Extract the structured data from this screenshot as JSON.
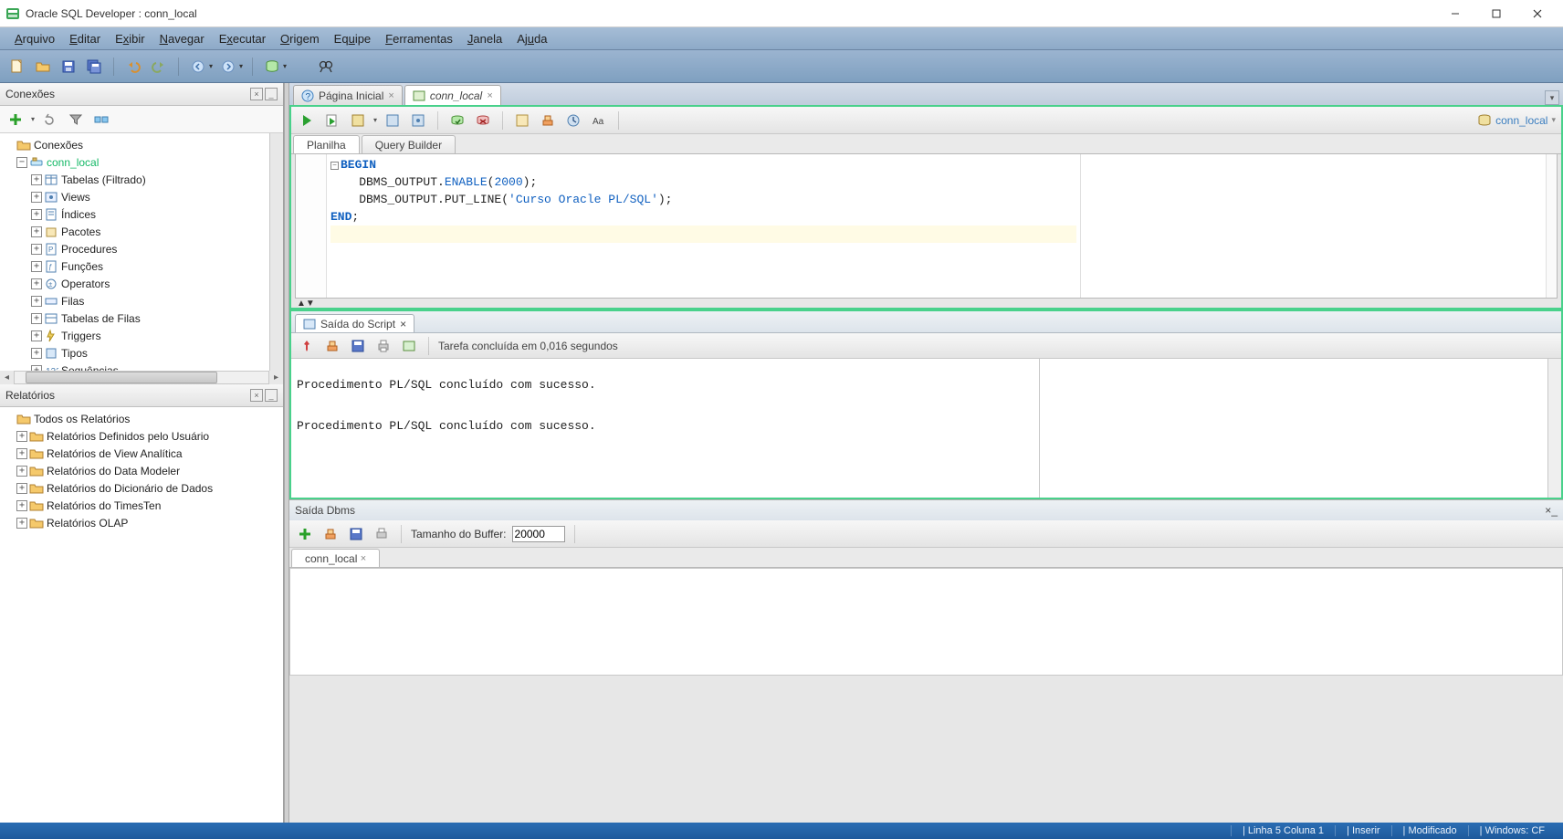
{
  "title": "Oracle SQL Developer : conn_local",
  "menubar": [
    "Arquivo",
    "Editar",
    "Exibir",
    "Navegar",
    "Executar",
    "Origem",
    "Equipe",
    "Ferramentas",
    "Janela",
    "Ajuda"
  ],
  "leftpanels": {
    "connections_title": "Conexões",
    "conn_root": "Conexões",
    "conn_name": "conn_local",
    "tree_items": [
      "Tabelas (Filtrado)",
      "Views",
      "Índices",
      "Pacotes",
      "Procedures",
      "Funções",
      "Operators",
      "Filas",
      "Tabelas de Filas",
      "Triggers",
      "Tipos",
      "Sequências"
    ],
    "reports_title": "Relatórios",
    "reports_root": "Todos os Relatórios",
    "reports_items": [
      "Relatórios Definidos pelo Usuário",
      "Relatórios de View Analítica",
      "Relatórios do Data Modeler",
      "Relatórios do Dicionário de Dados",
      "Relatórios do TimesTen",
      "Relatórios OLAP"
    ]
  },
  "doctabs": {
    "tab1": "Página Inicial",
    "tab2": "conn_local"
  },
  "worksheet_tabs": {
    "planilha": "Planilha",
    "qb": "Query Builder"
  },
  "sql_conn_label": "conn_local",
  "code": {
    "l1a": "BEGIN",
    "l2a": "    DBMS_OUTPUT.",
    "l2b": "ENABLE",
    "l2c": "(",
    "l2d": "2000",
    "l2e": ");",
    "l3a": "    DBMS_OUTPUT.PUT_LINE(",
    "l3b": "'Curso Oracle PL/SQL'",
    "l3c": ");",
    "l4a": "END",
    "l4b": ";"
  },
  "script_output": {
    "tab_label": "Saída do Script",
    "task_msg": "Tarefa concluída em 0,016 segundos",
    "body": "\nProcedimento PL/SQL concluído com sucesso.\n\n\nProcedimento PL/SQL concluído com sucesso.\n"
  },
  "dbms": {
    "title": "Saída Dbms",
    "buffer_label": "Tamanho do Buffer:",
    "buffer_value": "20000",
    "tab": "conn_local"
  },
  "statusbar": {
    "pos": "Linha 5 Coluna 1",
    "mode": "Inserir",
    "state": "Modificado",
    "enc": "Windows: CF"
  }
}
